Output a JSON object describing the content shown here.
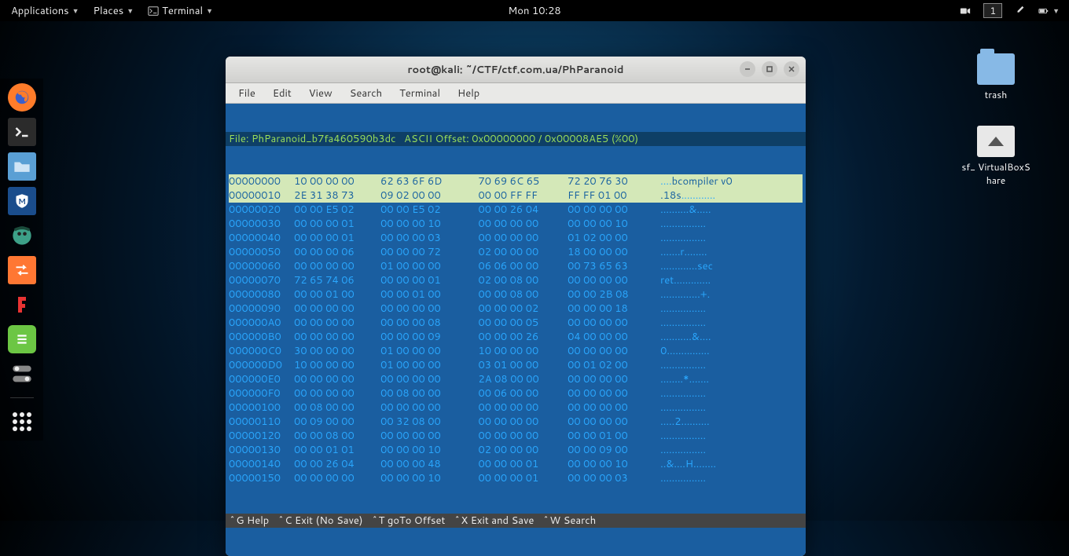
{
  "topbar": {
    "applications": "Applications",
    "places": "Places",
    "terminal": "Terminal",
    "clock": "Mon 10:28",
    "workspace": "1"
  },
  "desktop": {
    "trash": "trash",
    "share": "sf_ VirtualBoxS hare"
  },
  "window": {
    "title": "root@kali: ~/CTF/ctf.com.ua/PhParanoid",
    "menu": [
      "File",
      "Edit",
      "View",
      "Search",
      "Terminal",
      "Help"
    ]
  },
  "hex": {
    "status": "File: PhParanoid_b7fa460590b3dc   ASCII Offset: 0x00000000 / 0x00008AE5 (%00)    ",
    "rows": [
      {
        "addr": "00000000",
        "g": [
          "10 00 00 00",
          "62 63 6F 6D",
          "70 69 6C 65",
          "72 20 76 30"
        ],
        "ascii": "....bcompiler v0",
        "hl": true,
        "asciiHL": "bcompiler v0"
      },
      {
        "addr": "00000010",
        "g": [
          "2E 31 38 73",
          "09 02 00 00",
          "00 00 FF FF",
          "FF FF 01 00"
        ],
        "ascii": ".18s............",
        "hl": true,
        "asciiHL": ".18s"
      },
      {
        "addr": "00000020",
        "g": [
          "00 00 E5 02",
          "00 00 E5 02",
          "00 00 26 04",
          "00 00 00 00"
        ],
        "ascii": "..........&....."
      },
      {
        "addr": "00000030",
        "g": [
          "00 00 00 01",
          "00 00 00 10",
          "00 00 00 00",
          "00 00 00 10"
        ],
        "ascii": "................"
      },
      {
        "addr": "00000040",
        "g": [
          "00 00 00 01",
          "00 00 00 03",
          "00 00 00 00",
          "01 02 00 00"
        ],
        "ascii": "................"
      },
      {
        "addr": "00000050",
        "g": [
          "00 00 00 06",
          "00 00 00 72",
          "02 00 00 00",
          "18 00 00 00"
        ],
        "ascii": ".......r........"
      },
      {
        "addr": "00000060",
        "g": [
          "00 00 00 00",
          "01 00 00 00",
          "06 06 00 00",
          "00 73 65 63"
        ],
        "ascii": ".............sec"
      },
      {
        "addr": "00000070",
        "g": [
          "72 65 74 06",
          "00 00 00 01",
          "02 00 08 00",
          "00 00 00 00"
        ],
        "ascii": "ret............."
      },
      {
        "addr": "00000080",
        "g": [
          "00 00 01 00",
          "00 00 01 00",
          "00 00 08 00",
          "00 00 2B 08"
        ],
        "ascii": "..............+."
      },
      {
        "addr": "00000090",
        "g": [
          "00 00 00 00",
          "00 00 00 00",
          "00 00 00 02",
          "00 00 00 18"
        ],
        "ascii": "................"
      },
      {
        "addr": "000000A0",
        "g": [
          "00 00 00 00",
          "00 00 00 08",
          "00 00 00 05",
          "00 00 00 00"
        ],
        "ascii": "................"
      },
      {
        "addr": "000000B0",
        "g": [
          "00 00 00 00",
          "00 00 00 09",
          "00 00 00 26",
          "04 00 00 00"
        ],
        "ascii": "...........&...."
      },
      {
        "addr": "000000C0",
        "g": [
          "30 00 00 00",
          "01 00 00 00",
          "10 00 00 00",
          "00 00 00 00"
        ],
        "ascii": "0..............."
      },
      {
        "addr": "000000D0",
        "g": [
          "10 00 00 00",
          "01 00 00 00",
          "03 01 00 00",
          "00 01 02 00"
        ],
        "ascii": "................"
      },
      {
        "addr": "000000E0",
        "g": [
          "00 00 00 00",
          "00 00 00 00",
          "2A 08 00 00",
          "00 00 00 00"
        ],
        "ascii": "........*......."
      },
      {
        "addr": "000000F0",
        "g": [
          "00 00 00 00",
          "00 08 00 00",
          "00 06 00 00",
          "00 00 00 00"
        ],
        "ascii": "................"
      },
      {
        "addr": "00000100",
        "g": [
          "00 08 00 00",
          "00 00 00 00",
          "00 00 00 00",
          "00 00 00 00"
        ],
        "ascii": "................"
      },
      {
        "addr": "00000110",
        "g": [
          "00 09 00 00",
          "00 32 08 00",
          "00 00 00 00",
          "00 00 00 00"
        ],
        "ascii": ".....2.........."
      },
      {
        "addr": "00000120",
        "g": [
          "00 00 08 00",
          "00 00 00 00",
          "00 00 00 00",
          "00 00 01 00"
        ],
        "ascii": "................"
      },
      {
        "addr": "00000130",
        "g": [
          "00 00 01 01",
          "00 00 00 10",
          "02 00 00 00",
          "00 00 09 00"
        ],
        "ascii": "................"
      },
      {
        "addr": "00000140",
        "g": [
          "00 00 26 04",
          "00 00 00 48",
          "00 00 00 01",
          "00 00 00 10"
        ],
        "ascii": "..&....H........"
      },
      {
        "addr": "00000150",
        "g": [
          "00 00 00 00",
          "00 00 00 10",
          "00 00 00 01",
          "00 00 00 03"
        ],
        "ascii": "................"
      }
    ],
    "help": "^G Help   ^C Exit (No Save)   ^T goTo Offset   ^X Exit and Save   ^W Search     "
  }
}
